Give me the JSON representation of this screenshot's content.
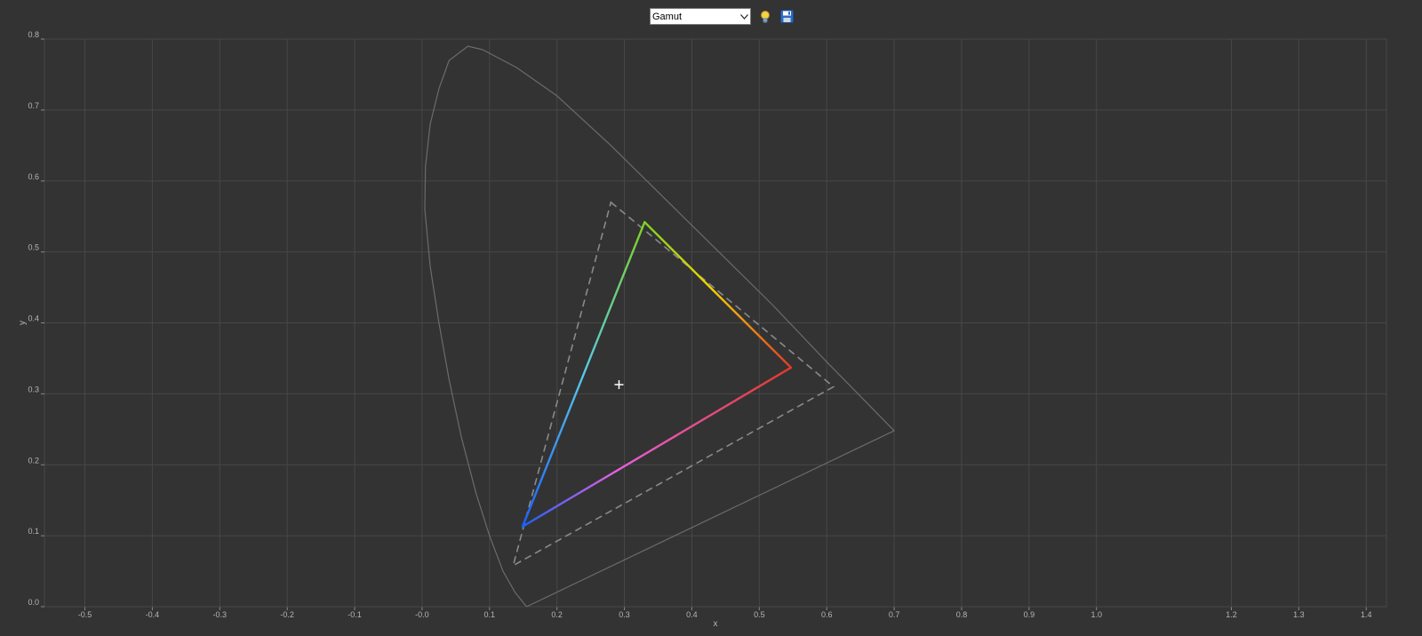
{
  "toolbar": {
    "mode_value": "Gamut",
    "mode_options": [
      "Gamut"
    ],
    "icons": [
      "lightbulb-icon",
      "save-icon"
    ]
  },
  "chart_data": {
    "type": "scatter",
    "title": "",
    "xlabel": "x",
    "ylabel": "y",
    "xlim": [
      -0.56,
      1.43
    ],
    "ylim": [
      0.0,
      0.8
    ],
    "x_ticks": [
      -0.5,
      -0.4,
      -0.3,
      -0.2,
      -0.1,
      0.0,
      0.1,
      0.2,
      0.3,
      0.4,
      0.5,
      0.6,
      0.7,
      0.8,
      0.9,
      1.0,
      1.2,
      1.3,
      1.4
    ],
    "x_tick_labels": [
      "-0.5",
      "-0.4",
      "-0.3",
      "-0.2",
      "-0.1",
      "-0.0",
      "0.1",
      "0.2",
      "0.3",
      "0.4",
      "0.5",
      "0.6",
      "0.7",
      "0.8",
      "0.9",
      "1.0",
      "1.2",
      "1.3",
      "1.4"
    ],
    "y_ticks": [
      0.0,
      0.1,
      0.2,
      0.3,
      0.4,
      0.5,
      0.6,
      0.7,
      0.8
    ],
    "y_tick_labels": [
      "0.0",
      "0.1",
      "0.2",
      "0.3",
      "0.4",
      "0.5",
      "0.6",
      "0.7",
      "0.8"
    ],
    "grid": true,
    "spectral_locus": [
      [
        0.155,
        0.0
      ],
      [
        0.138,
        0.02
      ],
      [
        0.12,
        0.05
      ],
      [
        0.1,
        0.1
      ],
      [
        0.08,
        0.16
      ],
      [
        0.058,
        0.24
      ],
      [
        0.04,
        0.32
      ],
      [
        0.025,
        0.4
      ],
      [
        0.012,
        0.48
      ],
      [
        0.004,
        0.56
      ],
      [
        0.005,
        0.62
      ],
      [
        0.012,
        0.68
      ],
      [
        0.025,
        0.73
      ],
      [
        0.04,
        0.77
      ],
      [
        0.068,
        0.79
      ],
      [
        0.09,
        0.785
      ],
      [
        0.14,
        0.76
      ],
      [
        0.2,
        0.72
      ],
      [
        0.28,
        0.65
      ],
      [
        0.36,
        0.575
      ],
      [
        0.44,
        0.5
      ],
      [
        0.52,
        0.425
      ],
      [
        0.6,
        0.345
      ],
      [
        0.7,
        0.248
      ],
      [
        0.155,
        0.0
      ]
    ],
    "reference_gamut": [
      [
        0.28,
        0.57
      ],
      [
        0.61,
        0.31
      ],
      [
        0.135,
        0.058
      ]
    ],
    "measured_gamut": {
      "red": [
        0.547,
        0.337
      ],
      "green": [
        0.33,
        0.542
      ],
      "blue": [
        0.149,
        0.113
      ],
      "colors": {
        "red": "#e23a28",
        "yellow": "#f5d400",
        "green": "#7ed321",
        "cyan": "#58c8e8",
        "blue": "#1a60ff",
        "magenta": "#e860e0"
      }
    },
    "white_point": [
      0.292,
      0.313
    ],
    "colors": {
      "background": "#333333",
      "grid": "#474747",
      "locus": "#6b6b6b",
      "reference": "#8a8a8a",
      "tick": "#b5b5b5"
    }
  }
}
